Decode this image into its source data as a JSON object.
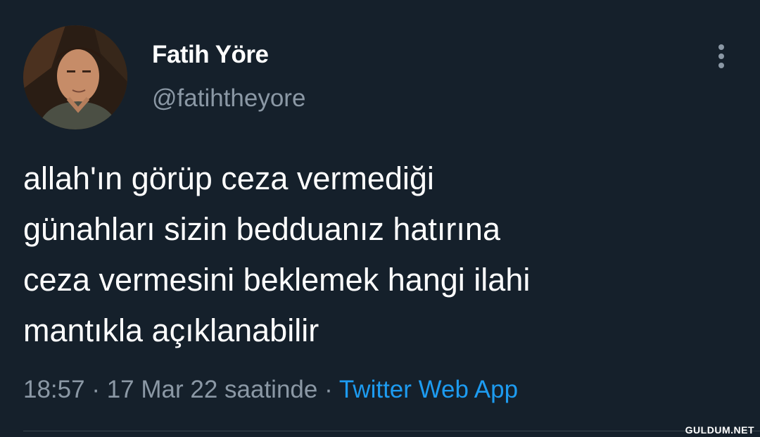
{
  "tweet": {
    "author": {
      "display_name": "Fatih Yöre",
      "handle": "@fatihtheyore",
      "avatar_icon": "profile-photo"
    },
    "more_icon": "more-vertical-icon",
    "text": "allah'ın görüp ceza vermediği\ngünahları sizin bedduanız hatırına\nceza vermesini beklemek hangi ilahi\nmantıkla açıklanabilir",
    "time": "18:57",
    "separator": "·",
    "date": "17 Mar 22 saatinde",
    "source": "Twitter Web App"
  },
  "colors": {
    "background": "#15202b",
    "text": "#ffffff",
    "secondary": "#8b98a5",
    "link": "#1d9bf0",
    "divider": "#38444d"
  },
  "watermark": "GULDUM.NET"
}
